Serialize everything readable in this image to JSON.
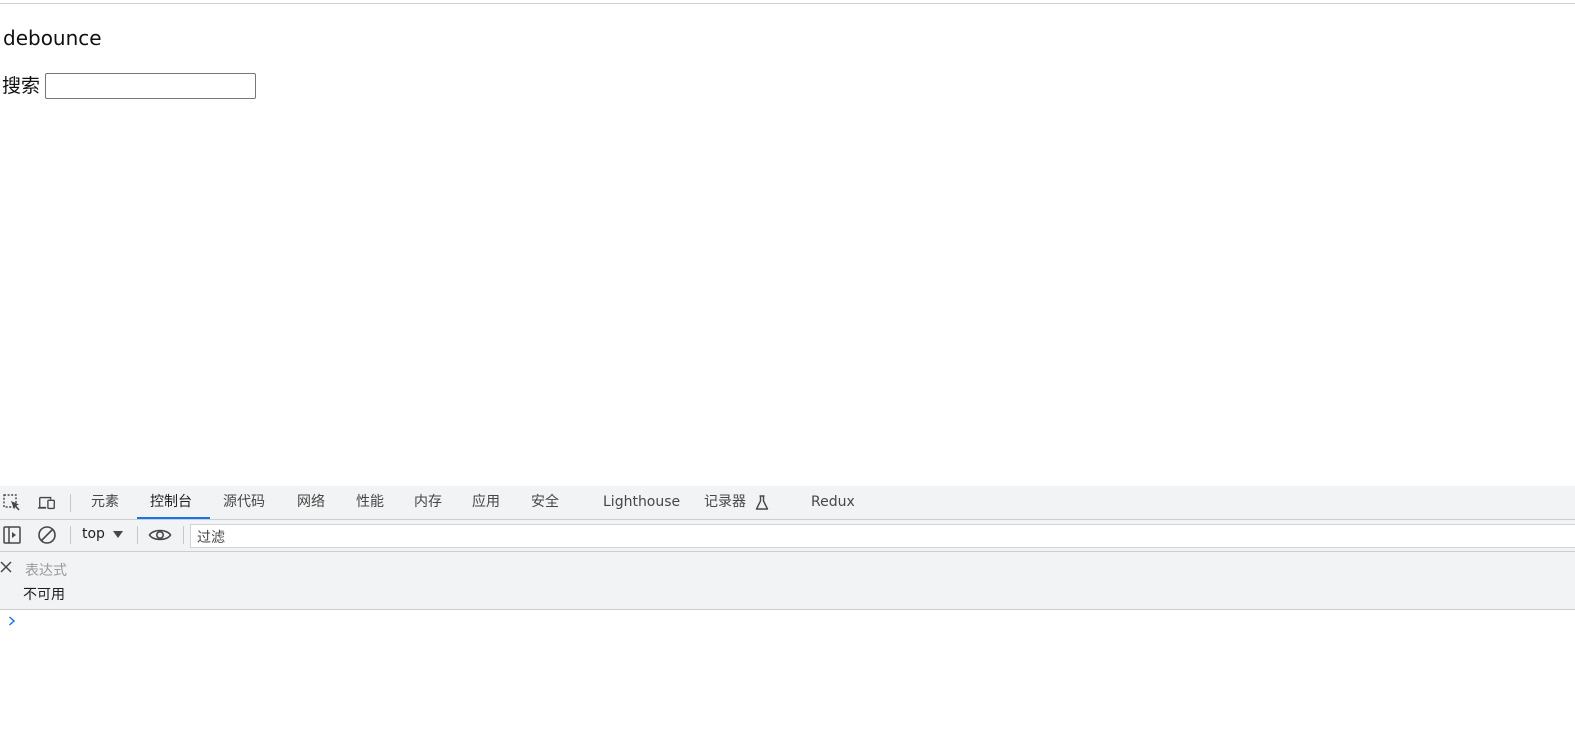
{
  "page": {
    "title": "debounce",
    "search_label": "搜索",
    "search_value": "",
    "search_placeholder": ""
  },
  "devtools": {
    "tabs": [
      {
        "label": "元素",
        "active": false
      },
      {
        "label": "控制台",
        "active": true
      },
      {
        "label": "源代码",
        "active": false
      },
      {
        "label": "网络",
        "active": false
      },
      {
        "label": "性能",
        "active": false
      },
      {
        "label": "内存",
        "active": false
      },
      {
        "label": "应用",
        "active": false
      },
      {
        "label": "安全",
        "active": false
      },
      {
        "label": "Lighthouse",
        "active": false
      },
      {
        "label": "记录器",
        "active": false
      },
      {
        "label": "Redux",
        "active": false
      }
    ],
    "console": {
      "context": "top",
      "filter_placeholder": "过滤",
      "live_expression_placeholder": "表达式",
      "live_expression_value": "不可用"
    },
    "icons": {
      "inspect": "inspect-element-icon",
      "device": "device-toolbar-icon",
      "sidebar": "show-sidebar-icon",
      "clear": "clear-console-icon",
      "eye": "live-expression-eye-icon",
      "close": "close-icon",
      "flask": "experimental-flask-icon",
      "prompt": "console-prompt-chevron-icon"
    },
    "colors": {
      "accent": "#1a73e8",
      "toolbar_bg": "#f1f3f4"
    }
  }
}
